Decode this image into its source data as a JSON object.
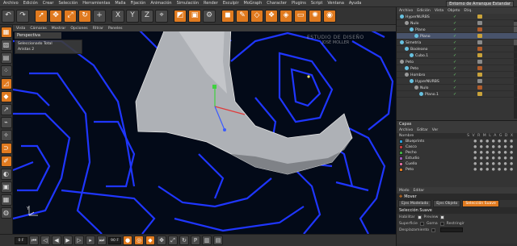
{
  "menubar": {
    "items": [
      "Archivo",
      "Edición",
      "Crear",
      "Selección",
      "Herramientas",
      "Malla",
      "Fijación",
      "Animación",
      "Simulación",
      "Render",
      "Esculpir",
      "MoGraph",
      "Character",
      "Plugins",
      "Script",
      "Ventana",
      "Ayuda"
    ],
    "layout_label": "Entorno de Arranque Estandar"
  },
  "viewport": {
    "menu": [
      "Vista",
      "Cámaras",
      "Mostrar",
      "Opciones",
      "Filtrar",
      "Paneles"
    ],
    "panel_label": "Perspectiva",
    "info": {
      "line1": "Seleccionado Total",
      "line2_label": "Aristas",
      "line2_value": "2"
    },
    "watermark": {
      "line1": "ESTUDIO DE DISEÑO",
      "line2": "JOSÉ MOLLER"
    },
    "axis_label": "Y"
  },
  "object_manager": {
    "tabs": [
      "Archivo",
      "Edición",
      "Vista",
      "Objeto",
      "Etiq."
    ],
    "items": [
      {
        "name": "HyperNURBS",
        "color": "#67c1e0",
        "selected": false
      },
      {
        "name": "Nulo",
        "color": "#9a9a9a",
        "selected": false
      },
      {
        "name": "Plano",
        "color": "#67c1e0",
        "selected": false
      },
      {
        "name": "Plano",
        "color": "#67c1e0",
        "selected": true
      },
      {
        "name": "Simetría",
        "color": "#67c1e0",
        "selected": false
      },
      {
        "name": "Booleano",
        "color": "#67c1e0",
        "selected": false
      },
      {
        "name": "Cubo.1",
        "color": "#67c1e0",
        "selected": false
      },
      {
        "name": "Peto",
        "color": "#9a9a9a",
        "selected": false
      },
      {
        "name": "Peto",
        "color": "#67c1e0",
        "selected": false
      },
      {
        "name": "Hombro",
        "color": "#9a9a9a",
        "selected": false
      },
      {
        "name": "HyperNURBS",
        "color": "#67c1e0",
        "selected": false
      },
      {
        "name": "Nulo",
        "color": "#9a9a9a",
        "selected": false
      },
      {
        "name": "Plano.1",
        "color": "#67c1e0",
        "selected": false
      }
    ]
  },
  "layers": {
    "title": "Capas",
    "menu": [
      "Archivo",
      "Editar",
      "Ver"
    ],
    "header": "Nombre",
    "header_icons": "S V R M L A G D X",
    "items": [
      {
        "name": "Blueprints",
        "color": "#2aa0d8"
      },
      {
        "name": "Casco",
        "color": "#c23b3b"
      },
      {
        "name": "Pecho",
        "color": "#3fae42"
      },
      {
        "name": "Estudio",
        "color": "#9b59b6"
      },
      {
        "name": "Cuello",
        "color": "#d86a9a"
      },
      {
        "name": "Peto",
        "color": "#e07a1f"
      }
    ]
  },
  "attributes": {
    "menu": [
      "Modo",
      "Editar"
    ],
    "tool": "Mover",
    "tabs": [
      "Ejes Modelado",
      "Ejes Objeto",
      "Selección Suave"
    ],
    "section_title": "Selección Suave",
    "rows": [
      {
        "label": "Habilitar",
        "checked": true,
        "extra_label": "Preview",
        "extra_checked": true
      },
      {
        "label": "Superficie",
        "checked": false,
        "extra_label": "Goma",
        "extra_checked": false,
        "extra2": "Restringir"
      },
      {
        "label": "Desplazamiento",
        "checked": false,
        "extra_label": "",
        "extra_checked": false
      }
    ]
  },
  "bottom_toolbar": {
    "frame_start": "0 F",
    "frame_end": "90 F"
  },
  "colors": {
    "accent": "#e07a1f",
    "wireframe": "#1f36ff",
    "viewport_bg": "#030a18",
    "selection": "#48536b"
  },
  "icons": {
    "top": [
      "undo-icon",
      "redo-icon",
      "select-arrow-icon",
      "move-icon",
      "scale-icon",
      "rotate-icon",
      "add-icon",
      "axis-x-icon",
      "axis-y-icon",
      "axis-z-icon",
      "coordinate-icon",
      "render-view-icon",
      "render-icon",
      "render-settings-icon",
      "cube-icon",
      "pen-icon",
      "subdivision-icon",
      "array-icon",
      "deformer-icon",
      "floor-icon",
      "light-icon",
      "camera-icon"
    ],
    "left": [
      "model-mode-icon",
      "texture-mode-icon",
      "workplane-icon",
      "points-mode-icon",
      "edges-mode-icon",
      "polygons-mode-icon",
      "axis-mode-icon",
      "snap-icon",
      "tweak-icon",
      "magnet-icon",
      "paint-icon",
      "sculpt-icon",
      "lock-icon",
      "grid-icon",
      "solo-icon"
    ],
    "bottom": [
      "go-start-icon",
      "prev-key-icon",
      "prev-frame-icon",
      "play-icon",
      "next-frame-icon",
      "next-key-icon",
      "go-end-icon",
      "record-icon",
      "autokey-icon",
      "keyframe-icon",
      "move-key-icon",
      "scale-key-icon",
      "rotate-key-icon",
      "param-key-icon",
      "pla-key-icon",
      "timeline-icon"
    ]
  }
}
